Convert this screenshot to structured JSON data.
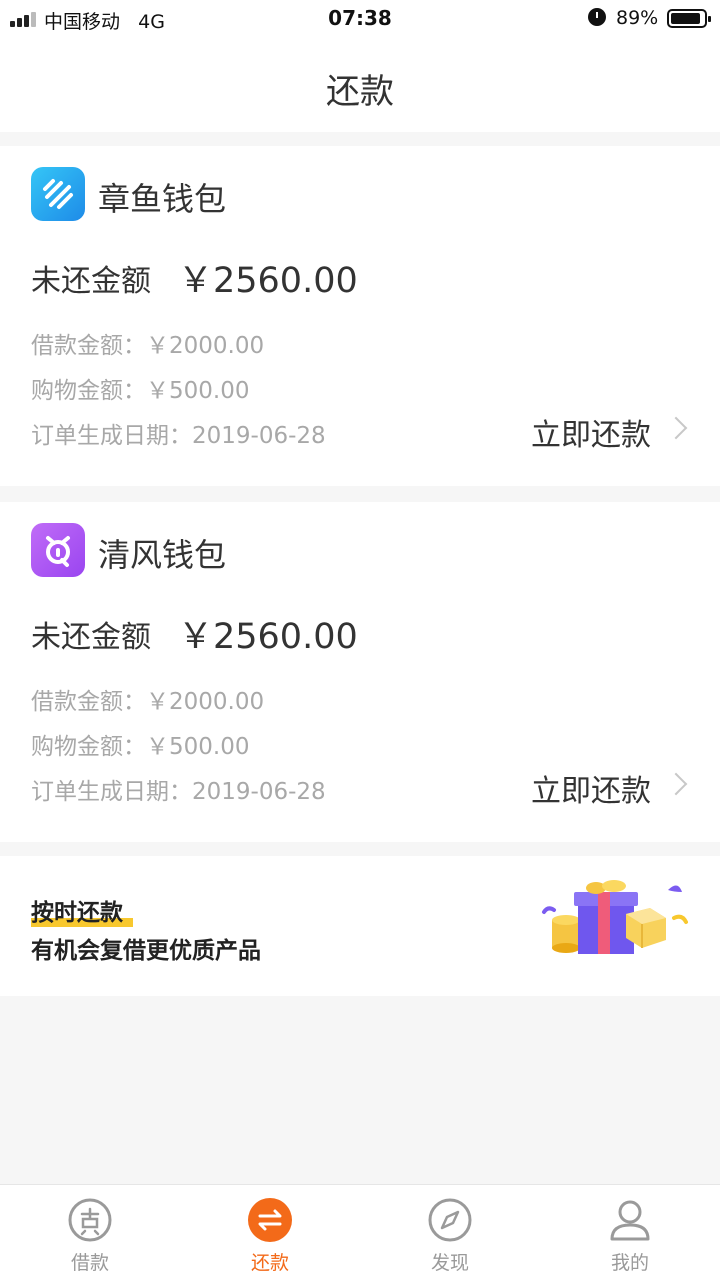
{
  "status_bar": {
    "carrier": "中国移动",
    "network": "4G",
    "time": "07:38",
    "battery": "89%"
  },
  "header": {
    "title": "还款"
  },
  "loans": [
    {
      "app_name": "章鱼钱包",
      "icon_color": "#2ea9f0",
      "owed_label": "未还金额",
      "owed_amount": "￥2560.00",
      "loan_line": "借款金额：￥2000.00",
      "shopping_line": "购物金额：￥500.00",
      "date_line": "订单生成日期：2019-06-28",
      "action": "立即还款"
    },
    {
      "app_name": "清风钱包",
      "icon_color": "#b15cf4",
      "owed_label": "未还金额",
      "owed_amount": "￥2560.00",
      "loan_line": "借款金额：￥2000.00",
      "shopping_line": "购物金额：￥500.00",
      "date_line": "订单生成日期：2019-06-28",
      "action": "立即还款"
    }
  ],
  "promo": {
    "title": "按时还款",
    "subtitle": "有机会复借更优质产品"
  },
  "tabs": [
    {
      "label": "借款",
      "icon": "loan-icon",
      "active": false
    },
    {
      "label": "还款",
      "icon": "repay-icon",
      "active": true
    },
    {
      "label": "发现",
      "icon": "compass-icon",
      "active": false
    },
    {
      "label": "我的",
      "icon": "profile-icon",
      "active": false
    }
  ],
  "colors": {
    "accent": "#f36a19",
    "highlight": "#f8c82e",
    "tab_inactive": "#9a9a9a"
  }
}
